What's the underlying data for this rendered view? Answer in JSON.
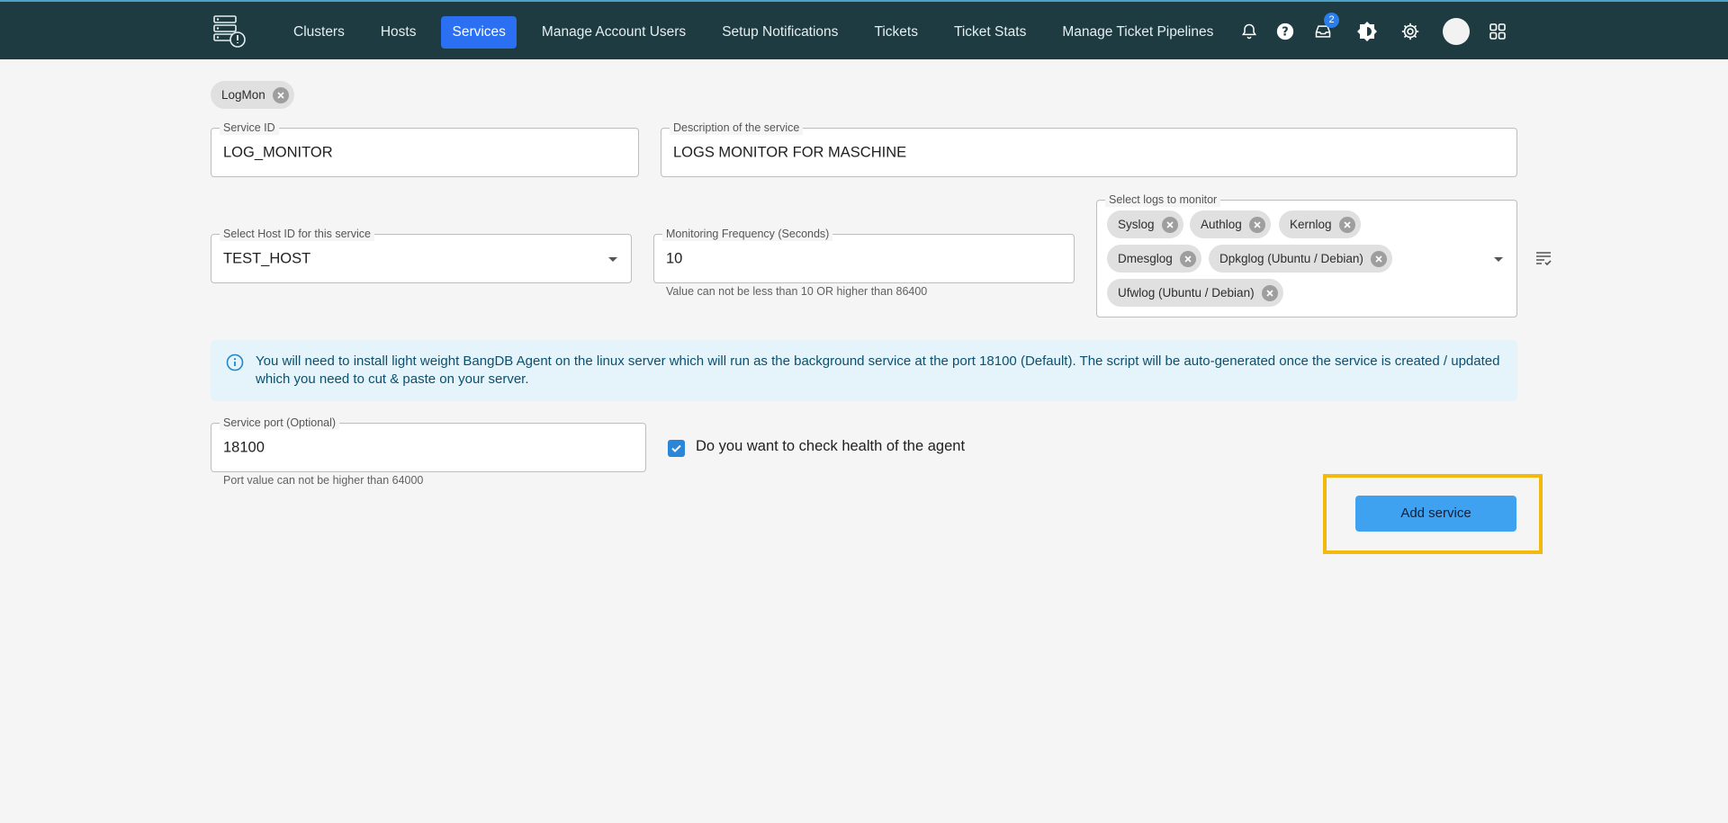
{
  "nav": {
    "items": [
      "Clusters",
      "Hosts",
      "Services",
      "Manage Account Users",
      "Setup Notifications",
      "Tickets",
      "Ticket Stats",
      "Manage Ticket Pipelines"
    ],
    "active": "Services",
    "inbox_badge": "2"
  },
  "service_tag": "LogMon",
  "form": {
    "service_id": {
      "label": "Service ID",
      "value": "LOG_MONITOR"
    },
    "description": {
      "label": "Description of the service",
      "value": "LOGS MONITOR FOR MASCHINE"
    },
    "host": {
      "label": "Select Host ID for this service",
      "value": "TEST_HOST"
    },
    "frequency": {
      "label": "Monitoring Frequency (Seconds)",
      "value": "10",
      "helper": "Value can not be less than 10 OR higher than 86400"
    },
    "logs": {
      "label": "Select logs to monitor",
      "selected": [
        "Syslog",
        "Authlog",
        "Kernlog",
        "Dmesglog",
        "Dpkglog (Ubuntu / Debian)",
        "Ufwlog (Ubuntu / Debian)"
      ]
    },
    "info_text": "You will need to install light weight BangDB Agent on the linux server which will run as the background service at the port 18100 (Default). The script will be auto-generated once the service is created / updated which you need to cut & paste on your server.",
    "port": {
      "label": "Service port (Optional)",
      "value": "18100",
      "helper": "Port value can not be higher than 64000"
    },
    "health_check": {
      "label": "Do you want to check health of the agent",
      "checked": true
    },
    "submit_label": "Add service"
  },
  "colors": {
    "topbar": "#1d3b40",
    "active_nav": "#2b6ff2",
    "button": "#3ea2f0",
    "highlight": "#f4b90e",
    "info_bg": "#e4f4fa"
  }
}
